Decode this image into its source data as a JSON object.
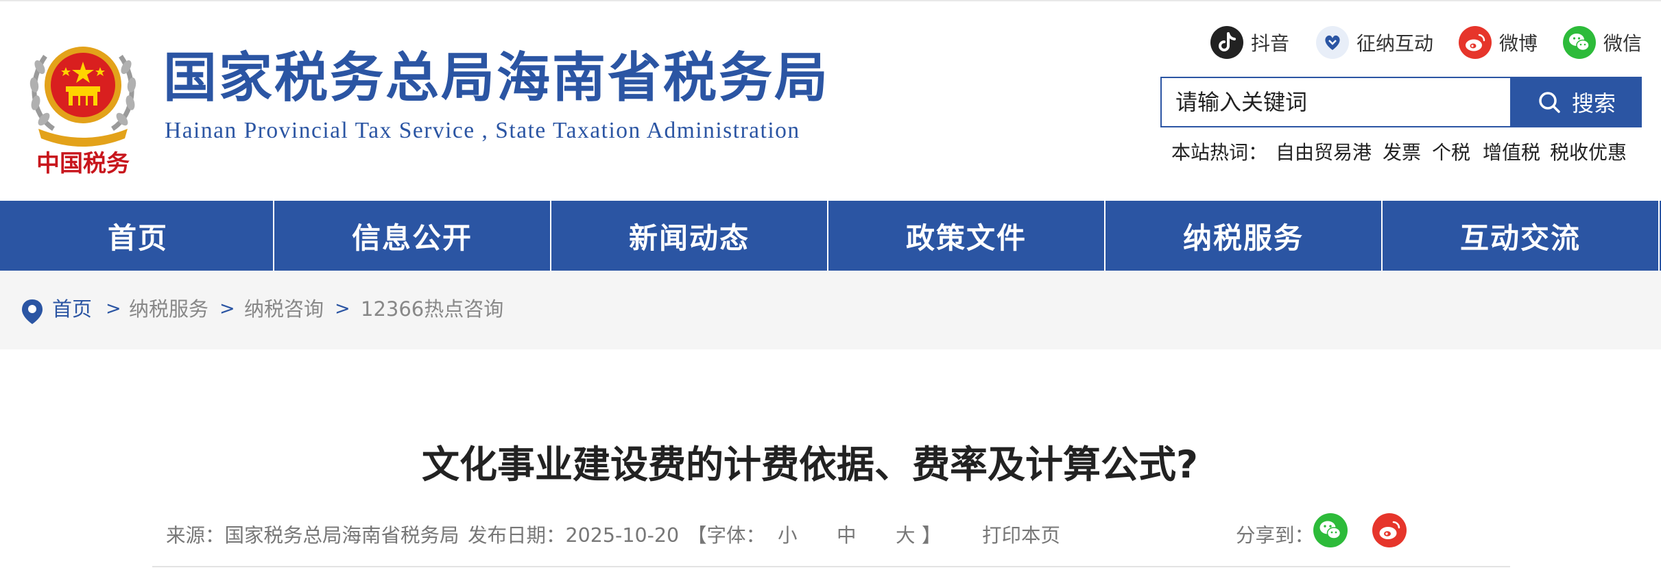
{
  "site": {
    "title": "国家税务总局海南省税务局",
    "subtitle": "Hainan  Provincial  Tax  Service  ,  State  Taxation  Administration",
    "emblem_text": "中国税务"
  },
  "social": [
    {
      "label": "抖音",
      "icon": "douyin-icon",
      "color": "#222222"
    },
    {
      "label": "征纳互动",
      "icon": "interaction-icon",
      "color": "#2b55a3"
    },
    {
      "label": "微博",
      "icon": "weibo-icon",
      "color": "#e6352b"
    },
    {
      "label": "微信",
      "icon": "wechat-icon",
      "color": "#2dbb3a"
    }
  ],
  "search": {
    "placeholder": "请输入关键词",
    "button_label": "搜索"
  },
  "hotwords": {
    "label": "本站热词：",
    "items": [
      "自由贸易港",
      "发票",
      "个税",
      "增值税",
      "税收优惠"
    ]
  },
  "nav": [
    "首页",
    "信息公开",
    "新闻动态",
    "政策文件",
    "纳税服务",
    "互动交流"
  ],
  "breadcrumb": {
    "items": [
      "首页",
      "纳税服务",
      "纳税咨询",
      "12366热点咨询"
    ],
    "separator": ">"
  },
  "article": {
    "title": "文化事业建设费的计费依据、费率及计算公式?",
    "meta": {
      "source": "来源：国家税务总局海南省税务局",
      "date": "发布日期：2025-10-20",
      "font_open": "【字体：",
      "font_small": "小",
      "font_medium": "中",
      "font_large": "大",
      "font_close": "】",
      "print": "打印本页",
      "share_label": "分享到："
    }
  },
  "colors": {
    "brand_blue": "#2b55a3",
    "breadcrumb_bg": "#f5f5f5",
    "wechat_green": "#2dbb3a",
    "weibo_red": "#e6352b"
  }
}
